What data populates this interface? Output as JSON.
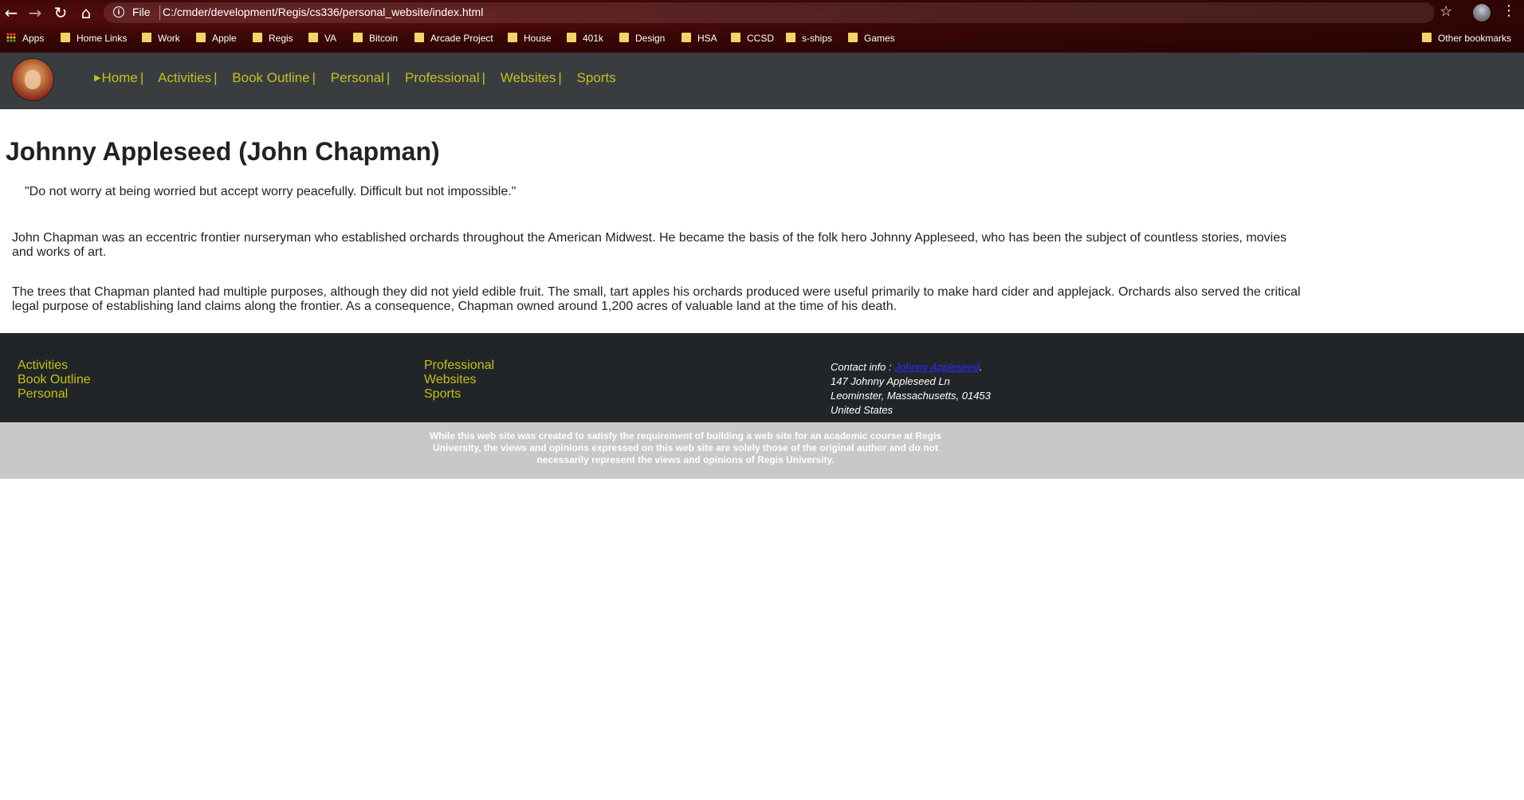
{
  "browser": {
    "scheme": "File",
    "url": "C:/cmder/development/Regis/cs336/personal_website/index.html",
    "icons": {
      "back": "arrow-left-icon",
      "forward": "arrow-right-icon",
      "reload": "reload-icon",
      "home": "home-icon",
      "info": "info-icon",
      "star": "star-icon",
      "menu": "kebab-menu-icon"
    },
    "bookmarks": [
      "Apps",
      "Home Links",
      "Work",
      "Apple",
      "Regis",
      "VA",
      "Bitcoin",
      "Arcade Project",
      "House",
      "401k",
      "Design",
      "HSA",
      "CCSD",
      "s-ships",
      "Games"
    ],
    "other_bookmarks": "Other bookmarks"
  },
  "site": {
    "nav": [
      "Home",
      "Activities",
      "Book Outline",
      "Personal",
      "Professional",
      "Websites",
      "Sports"
    ],
    "nav_separator": "|",
    "accent_color": "#c5bf21"
  },
  "main": {
    "title": "Johnny Appleseed (John Chapman)",
    "quote": "\"Do not worry at being worried but accept worry peacefully. Difficult but not impossible.\"",
    "paragraphs": [
      "John Chapman was an eccentric frontier nurseryman who established orchards throughout the American Midwest. He became the basis of the folk hero Johnny Appleseed, who has been the subject of countless stories, movies and works of art.",
      "The trees that Chapman planted had multiple purposes, although they did not yield edible fruit. The small, tart apples his orchards produced were useful primarily to make hard cider and applejack. Orchards also served the critical legal purpose of establishing land claims along the frontier. As a consequence, Chapman owned around 1,200 acres of valuable land at the time of his death."
    ]
  },
  "footer": {
    "col1": [
      "Activities",
      "Book Outline",
      "Personal"
    ],
    "col2": [
      "Professional",
      "Websites",
      "Sports"
    ],
    "contact_label": "Contact info :",
    "contact_link": "Johnny Appleseed",
    "contact_suffix": ".",
    "address": [
      "147 Johnny Appleseed Ln",
      "Leominster, Massachusetts, 01453",
      "United States"
    ],
    "disclaimer": "While this web site was created to satisfy the requirement of building a web site for an academic course at Regis University, the views and opinions expressed on this web site are solely those of the original author and do not necessarily represent the views and opinions of Regis University."
  }
}
